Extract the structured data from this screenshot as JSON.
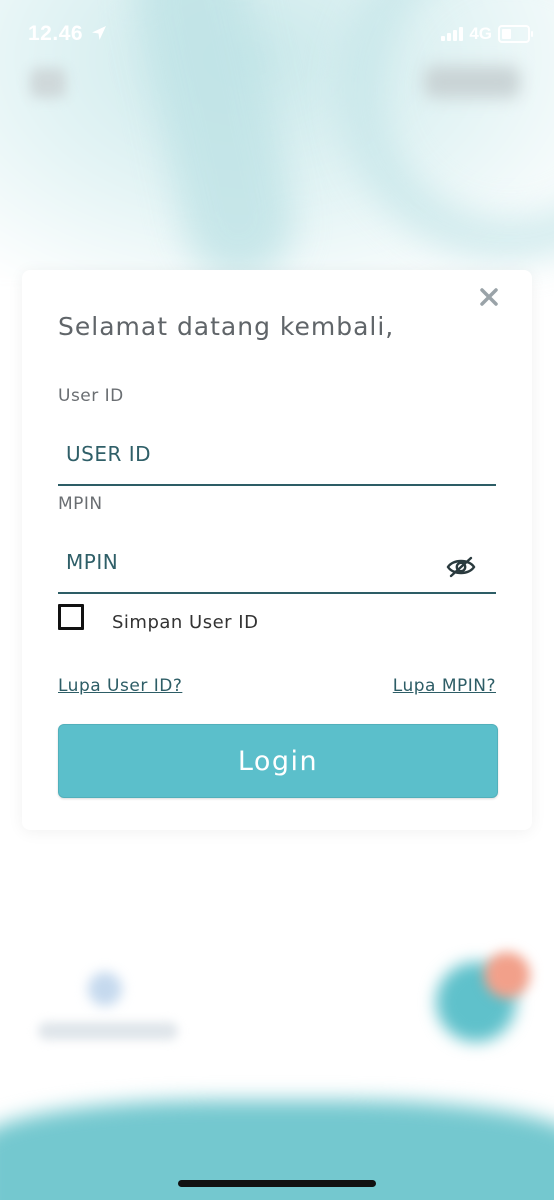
{
  "status_bar": {
    "time": "12.46",
    "network": "4G"
  },
  "login": {
    "greeting": "Selamat datang kembali,",
    "user_id_label": "User ID",
    "user_id_placeholder": "USER ID",
    "mpin_label": "MPIN",
    "mpin_placeholder": "MPIN",
    "remember_label": "Simpan User ID",
    "remember_checked": false,
    "forgot_user_id": "Lupa User ID?",
    "forgot_mpin": "Lupa MPIN?",
    "login_button": "Login"
  },
  "colors": {
    "accent": "#5bbfcb",
    "text_dark_teal": "#2d5d66"
  },
  "icons": {
    "close": "close-icon",
    "eye_off": "eye-off-icon",
    "location": "location-arrow-icon"
  }
}
